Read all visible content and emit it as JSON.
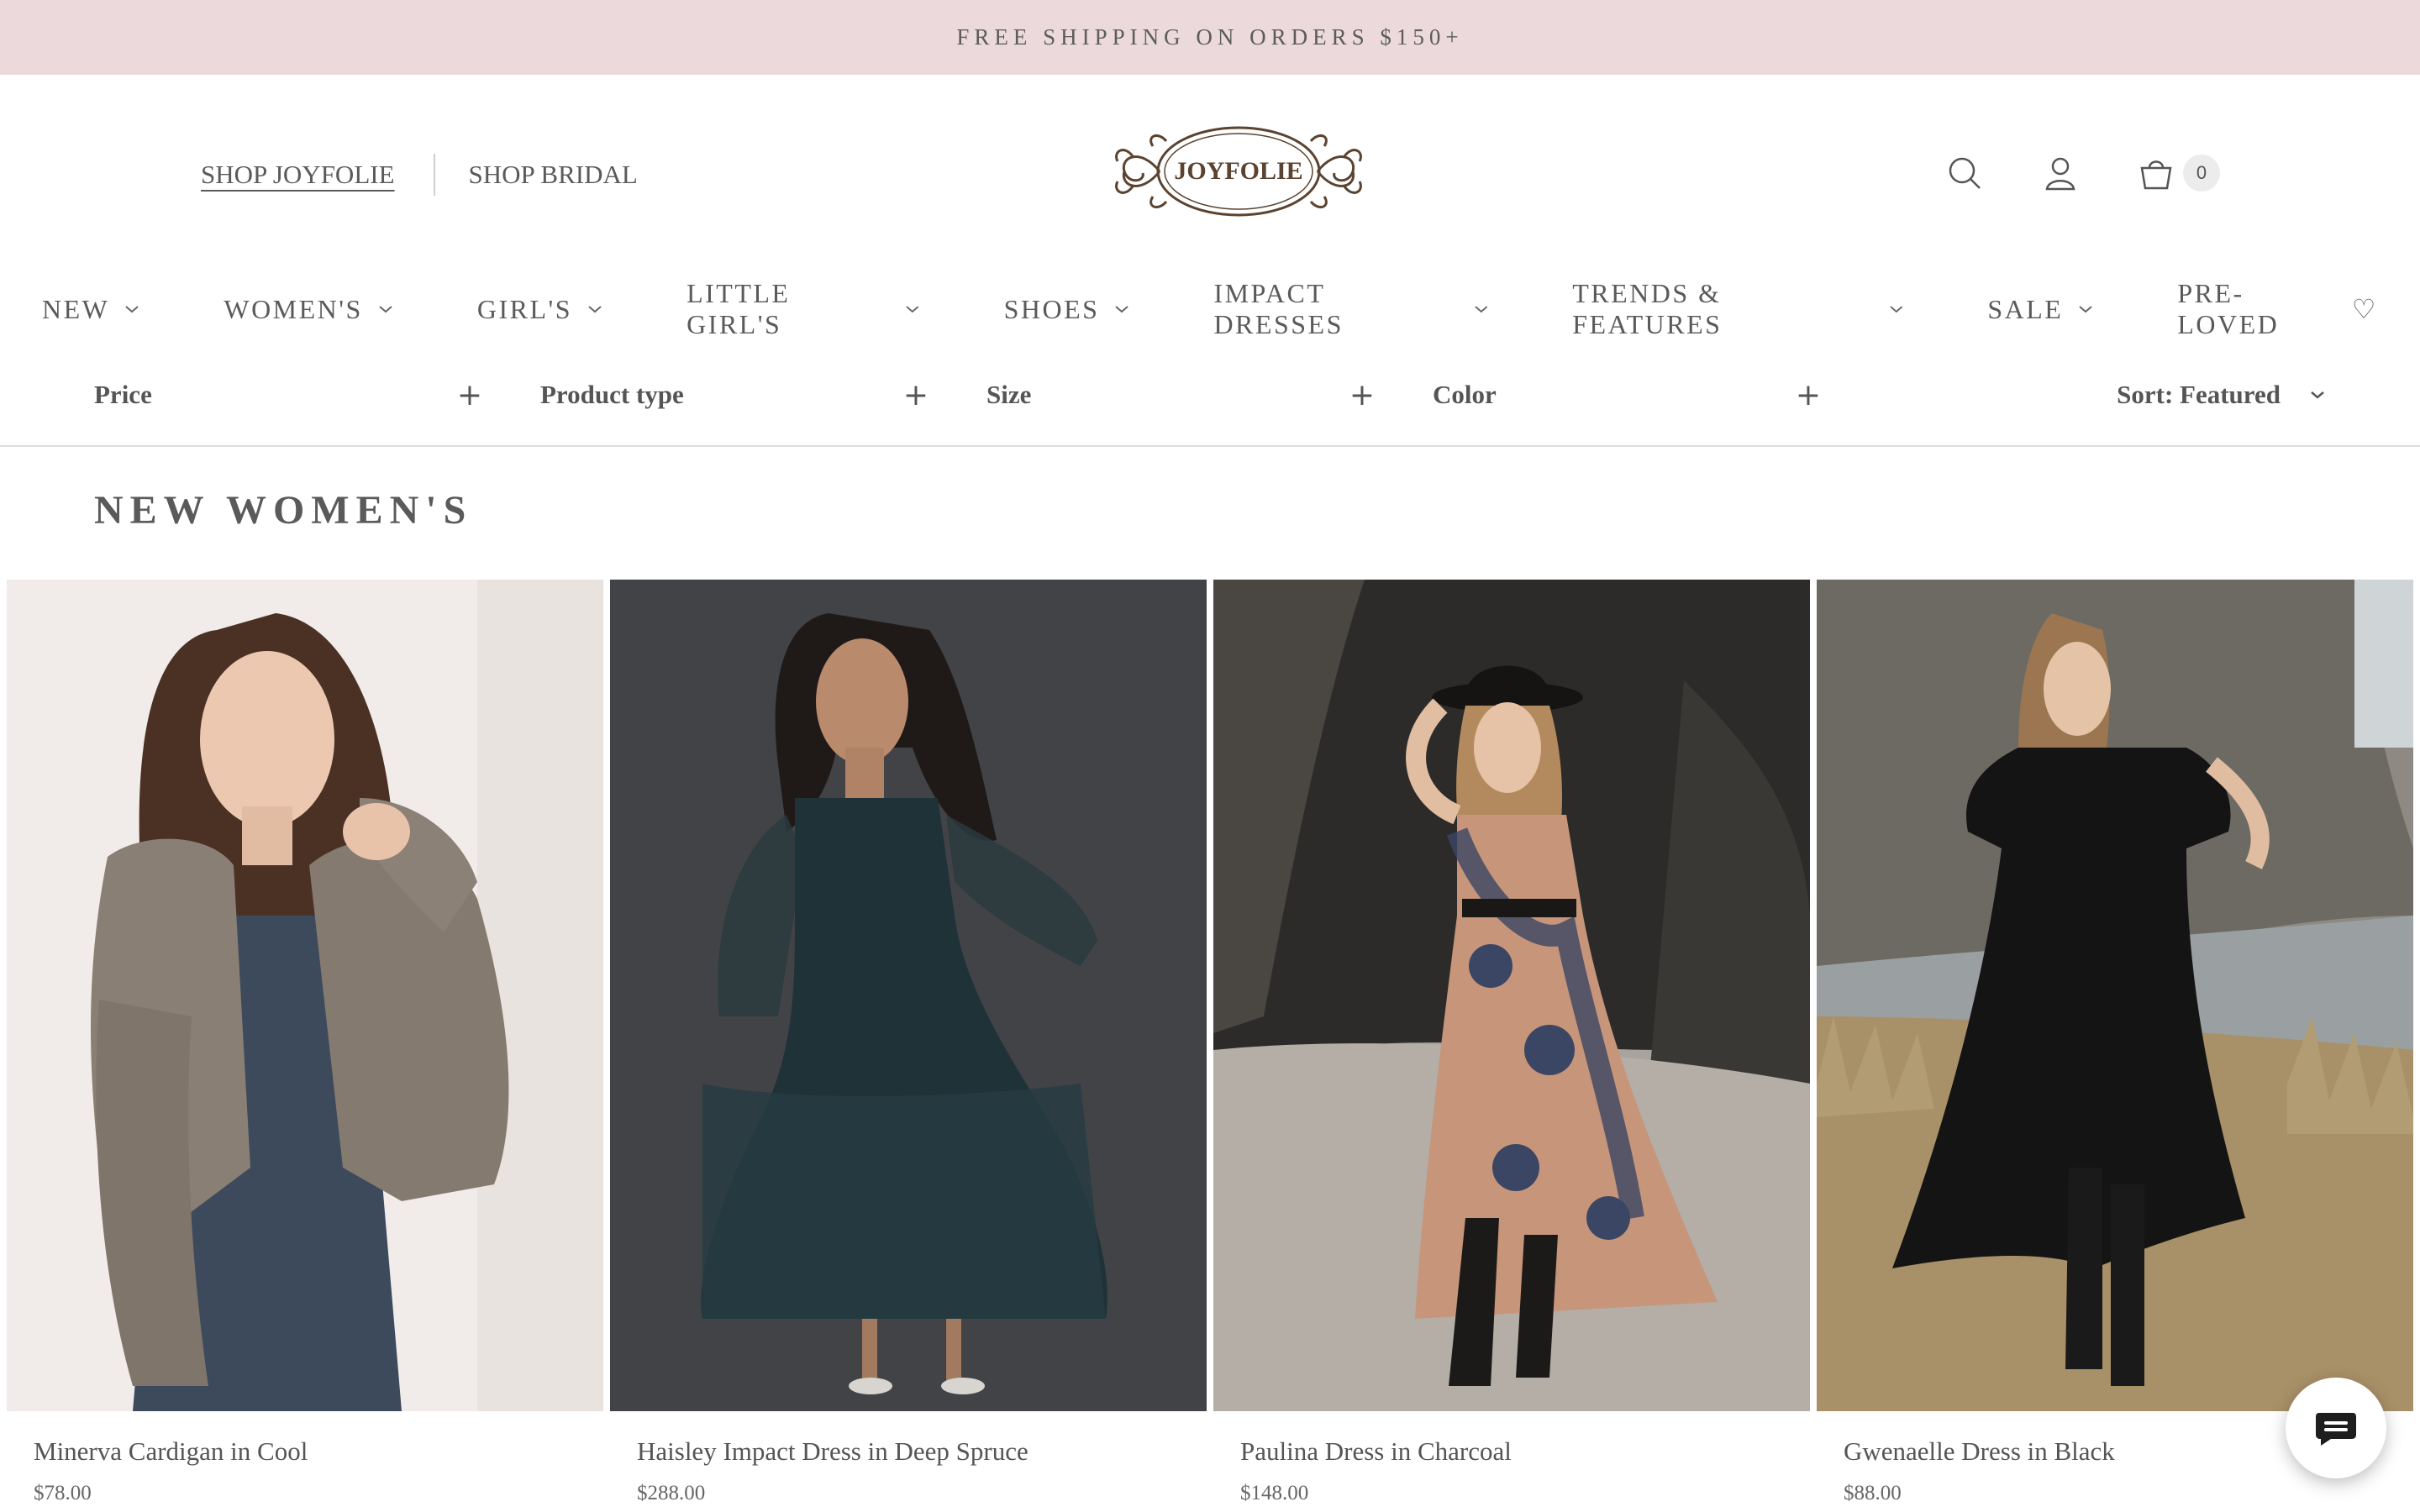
{
  "announcement": {
    "text": "FREE SHIPPING ON ORDERS $150+"
  },
  "header": {
    "sub_links": [
      {
        "label": "SHOP JOYFOLIE"
      },
      {
        "label": "SHOP BRIDAL"
      }
    ],
    "logo_text": "JOYFOLIE",
    "cart_count": "0",
    "icons": [
      "search-icon",
      "account-icon",
      "cart-icon"
    ]
  },
  "nav": {
    "items": [
      {
        "label": "NEW"
      },
      {
        "label": "WOMEN'S"
      },
      {
        "label": "GIRL'S"
      },
      {
        "label": "LITTLE GIRL'S"
      },
      {
        "label": "SHOES"
      },
      {
        "label": "IMPACT DRESSES"
      },
      {
        "label": "TRENDS & FEATURES"
      },
      {
        "label": "SALE"
      },
      {
        "label": "PRE-LOVED"
      }
    ]
  },
  "filters": {
    "items": [
      {
        "label": "Price"
      },
      {
        "label": "Product type"
      },
      {
        "label": "Size"
      },
      {
        "label": "Color"
      }
    ],
    "sort_label": "Sort: Featured"
  },
  "collection": {
    "title": "NEW WOMEN'S",
    "products": [
      {
        "name": "Minerva Cardigan in Cool",
        "price": "$78.00"
      },
      {
        "name": "Haisley Impact Dress in Deep Spruce",
        "price": "$288.00"
      },
      {
        "name": "Paulina Dress in Charcoal",
        "price": "$148.00"
      },
      {
        "name": "Gwenaelle Dress in Black",
        "price": "$88.00"
      }
    ]
  },
  "colors": {
    "announcement_bg": "#ecd9dc",
    "text": "#5a5a5a",
    "logo_brown": "#5b4330"
  }
}
